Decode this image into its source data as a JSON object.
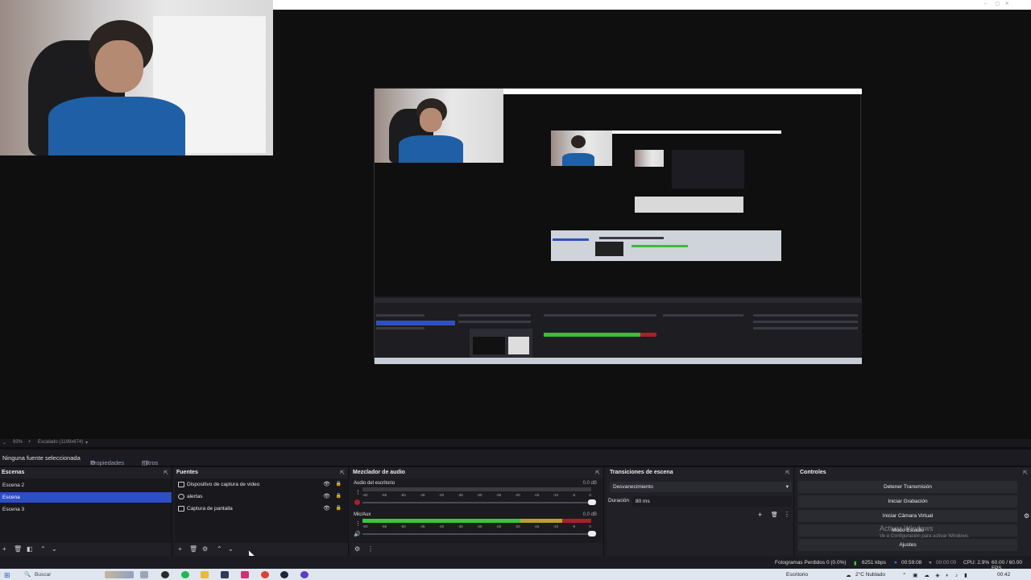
{
  "preview": {
    "zoom_label": "93%",
    "scale_label": "Escalado (1199x674)",
    "window_controls": [
      "–",
      "▢",
      "✕"
    ]
  },
  "properties_bar": {
    "no_source": "Ninguna fuente seleccionada",
    "properties": "Propiedades",
    "filters": "Filtros"
  },
  "scenes": {
    "title": "Escenas",
    "items": [
      "Escena 2",
      "Escena",
      "Escena 3"
    ],
    "selected": "Escena"
  },
  "sources": {
    "title": "Fuentes",
    "items": [
      "Dispositivo de captura de video",
      "alertas",
      "Captura de pantalla"
    ]
  },
  "mixer": {
    "title": "Mezclador de audio",
    "channels": [
      {
        "name": "Audio del escritorio",
        "db": "0.0 dB"
      },
      {
        "name": "Mic/Aux",
        "db": "0.0 dB"
      }
    ],
    "ticks": [
      "-60",
      "-55",
      "-50",
      "-45",
      "-40",
      "-35",
      "-30",
      "-25",
      "-20",
      "-15",
      "-10",
      "-5",
      "0"
    ]
  },
  "transitions": {
    "title": "Transiciones de escena",
    "selected": "Desvanecimiento",
    "duration_label": "Duración",
    "duration_value": "80 ms"
  },
  "controls": {
    "title": "Controles",
    "buttons": [
      "Detener Transmisión",
      "Iniciar Grabación",
      "Iniciar Cámara Virtual",
      "Modo Estudio",
      "Ajustes"
    ]
  },
  "watermark": {
    "line1": "Activar Windows",
    "line2": "Ve a Configuración para activar Windows."
  },
  "statusbar": {
    "dropped": "Fotogramas Perdidos 0 (0.0%)",
    "bitrate": "6251 kbps",
    "stream_time": "00:59:08",
    "rec_time": "00:00:00",
    "cpu": "CPU: 2.9%",
    "fps": "60.00 / 60.00 FPS"
  },
  "taskbar": {
    "search": "Buscar",
    "weather": "2°C  Nublado",
    "ime": "Escritorio",
    "clock": "00:42"
  },
  "colors": {
    "selection": "#2d4ec4",
    "meter_green": "#3fc43f",
    "meter_yellow": "#b9a030",
    "meter_red": "#a8202a"
  }
}
